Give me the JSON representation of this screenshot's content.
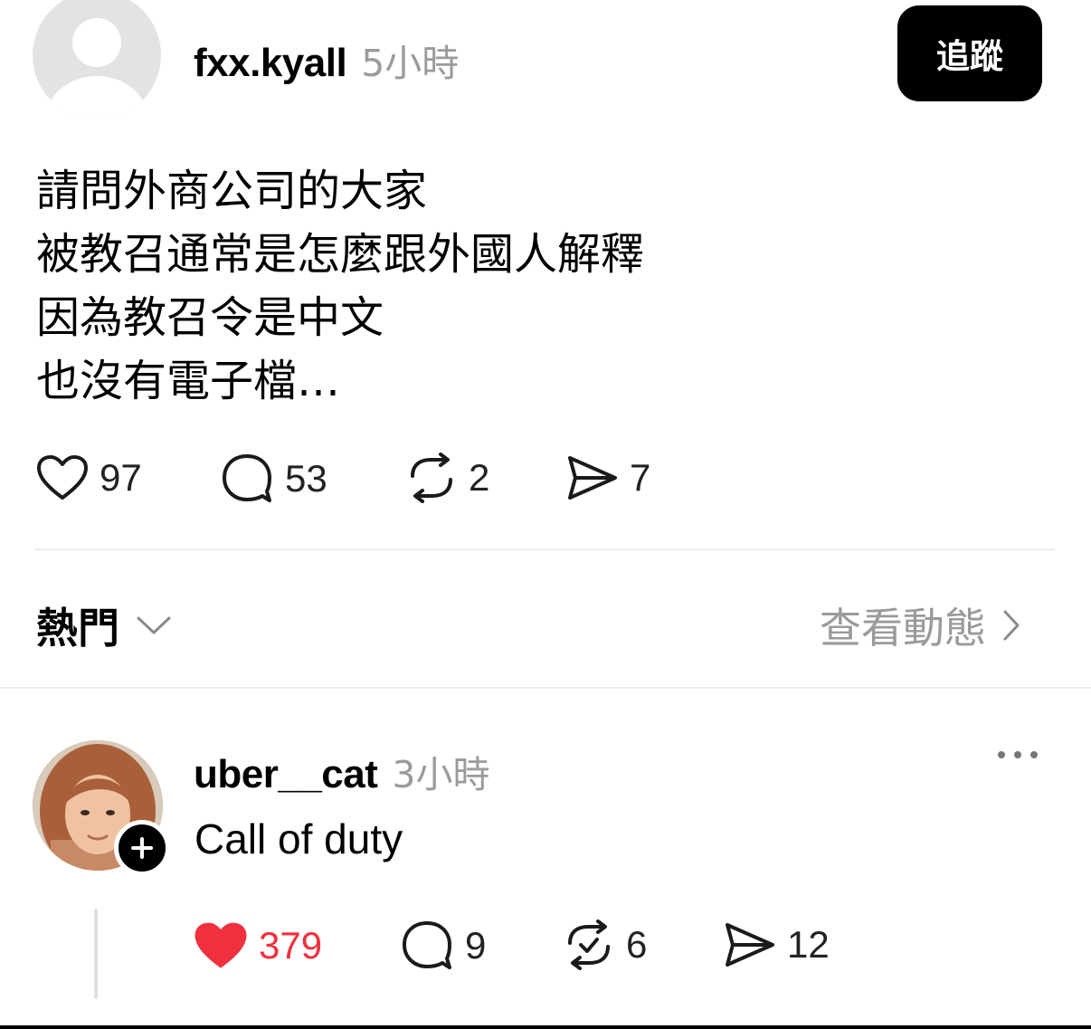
{
  "post": {
    "username": "fxx.kyall",
    "time": "5小時",
    "follow_label": "追蹤",
    "lines": [
      "請問外商公司的大家",
      "被教召通常是怎麼跟外國人解釋",
      "因為教召令是中文",
      "也沒有電子檔…"
    ],
    "likes": "97",
    "comments": "53",
    "reposts": "2",
    "shares": "7"
  },
  "sort": {
    "label": "熱門",
    "view_activity_label": "查看動態"
  },
  "reply": {
    "username": "uber__cat",
    "time": "3小時",
    "text": "Call of duty",
    "likes": "379",
    "comments": "9",
    "reposts": "6",
    "shares": "12",
    "liked": true
  },
  "colors": {
    "like_active": "#f0303e",
    "muted_text": "#9b9b9b",
    "follow_bg": "#000000"
  }
}
